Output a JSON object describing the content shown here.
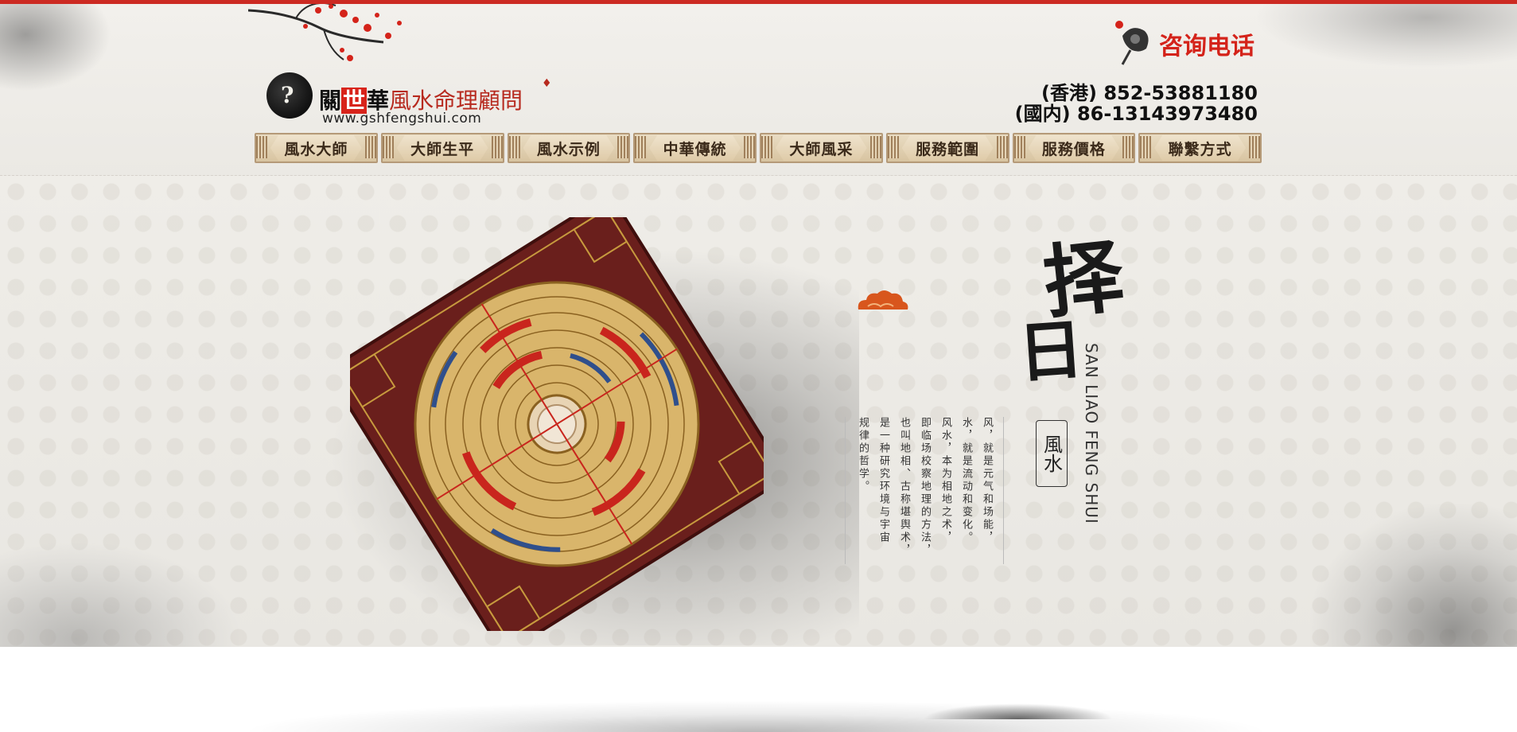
{
  "header": {
    "logo": {
      "brand_part1": "關",
      "brand_highlight": "世",
      "brand_part2": "華",
      "subtitle": "風水命理顧問",
      "url": "www.gshfengshui.com"
    },
    "consult_label": "咨询电话",
    "phones": [
      "(香港) 852-53881180",
      "(國内) 86-13143973480"
    ]
  },
  "nav": {
    "items": [
      {
        "label": "風水大師"
      },
      {
        "label": "大師生平"
      },
      {
        "label": "風水示例"
      },
      {
        "label": "中華傳統"
      },
      {
        "label": "大師風采"
      },
      {
        "label": "服務範圍"
      },
      {
        "label": "服務價格"
      },
      {
        "label": "聯繫方式"
      }
    ]
  },
  "hero": {
    "calligraphy_1": "择",
    "calligraphy_2": "日",
    "romanization": "SAN LIAO FENG SHUI",
    "seal_text": "風水",
    "description_columns": [
      "风，就是元气和场能，",
      "水，就是流动和变化。",
      "风水，本为相地之术，",
      "即临场校察地理的方法，",
      "也叫地相、古称堪舆术，",
      "是一种研究环境与宇宙",
      "规律的哲学。"
    ]
  },
  "icons": {
    "logo": "yin-yang-dragon-icon",
    "consult": "vintage-phone-icon",
    "branch": "plum-blossom-branch",
    "cloud": "auspicious-cloud-icon",
    "hero_image": "luopan-compass"
  },
  "colors": {
    "accent_red": "#d4231a",
    "top_strip": "#cc2a22",
    "nav_brown": "#3b2a1a"
  }
}
